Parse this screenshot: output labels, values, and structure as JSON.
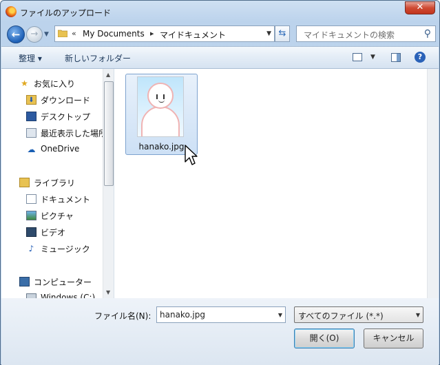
{
  "window": {
    "title": "ファイルのアップロード",
    "close_label": "✕"
  },
  "address": {
    "crumbs": [
      "My Documents",
      "マイドキュメント"
    ],
    "separator_first": "«",
    "separator": "▸"
  },
  "search": {
    "placeholder": "マイドキュメントの検索"
  },
  "toolbar": {
    "organize_label": "整理 ▾",
    "new_folder_label": "新しいフォルダー",
    "help_label": "?"
  },
  "nav": {
    "favorites": {
      "label": "お気に入り",
      "items": [
        "ダウンロード",
        "デスクトップ",
        "最近表示した場所"
      ]
    },
    "onedrive": "OneDrive",
    "libraries": {
      "label": "ライブラリ",
      "items": [
        "ドキュメント",
        "ピクチャ",
        "ビデオ",
        "ミュージック"
      ]
    },
    "computer": {
      "label": "コンピューター",
      "items": [
        "Windows (C:)"
      ]
    }
  },
  "files": [
    {
      "name": "hanako.jpg",
      "selected": true
    }
  ],
  "footer": {
    "filename_label": "ファイル名(N):",
    "filename_value": "hanako.jpg",
    "filetype_value": "すべてのファイル (*.*)",
    "open_label": "開く(O)",
    "cancel_label": "キャンセル"
  },
  "colors": {
    "accent": "#2a62b8",
    "selection": "#cde0f5"
  }
}
